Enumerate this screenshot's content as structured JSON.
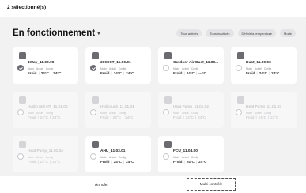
{
  "header": {
    "selection_count": "2 sélectionné(s)"
  },
  "main": {
    "status_title": "En fonctionnement",
    "filters": [
      "Tous activés",
      "Tous inactivés",
      "Définir la température",
      "Mode"
    ]
  },
  "labels": {
    "mode": "Mode",
    "actuel": "Actuel",
    "config": "Config"
  },
  "cards": [
    {
      "name": "1Way_11.00.00",
      "mode": "Froid",
      "actuel": "24°C",
      "config": "24°C",
      "selected": true,
      "active": true
    },
    {
      "name": "360CST_11.00.01",
      "mode": "Froid",
      "actuel": "24°C",
      "config": "24°C",
      "selected": true,
      "active": true
    },
    {
      "name": "Outdoor Air Duct_11.00...",
      "mode": "Froid",
      "actuel": "24°C",
      "config": "---°C",
      "selected": false,
      "active": true
    },
    {
      "name": "Duct_11.00.03",
      "mode": "Froid",
      "actuel": "24°C",
      "config": "24°C",
      "selected": false,
      "active": true
    },
    {
      "name": "Hydro unit HT_11.01.00",
      "mode": "Froid",
      "actuel": "24°C",
      "config": "24°C",
      "selected": false,
      "active": false
    },
    {
      "name": "Hydro unit_11.01.01",
      "mode": "Froid",
      "actuel": "24°C",
      "config": "24°C",
      "selected": false,
      "active": false
    },
    {
      "name": "Heat Pump_11.01.02",
      "mode": "Froid",
      "actuel": "24°C",
      "config": "24°C",
      "selected": false,
      "active": false
    },
    {
      "name": "Heat Pump_11.01.03",
      "mode": "Froid",
      "actuel": "24°C",
      "config": "24°C",
      "selected": false,
      "active": false
    },
    {
      "name": "Heat Pump_11.01.04",
      "mode": "Froid",
      "actuel": "24°C",
      "config": "24°C",
      "selected": false,
      "active": false
    },
    {
      "name": "AHU_11.03.01",
      "mode": "Froid",
      "actuel": "24°C",
      "config": "24°C",
      "selected": false,
      "active": true
    },
    {
      "name": "FCU_11.04.00",
      "mode": "Froid",
      "actuel": "24°C",
      "config": "24°C",
      "selected": false,
      "active": true
    }
  ],
  "footer": {
    "cancel_label": "Annuler",
    "multi_label": "Multi-contrôle"
  },
  "colors": {
    "check_on": "#6a6a70",
    "card_bg": "#ffffff",
    "page_bg": "#f2f2f3"
  }
}
